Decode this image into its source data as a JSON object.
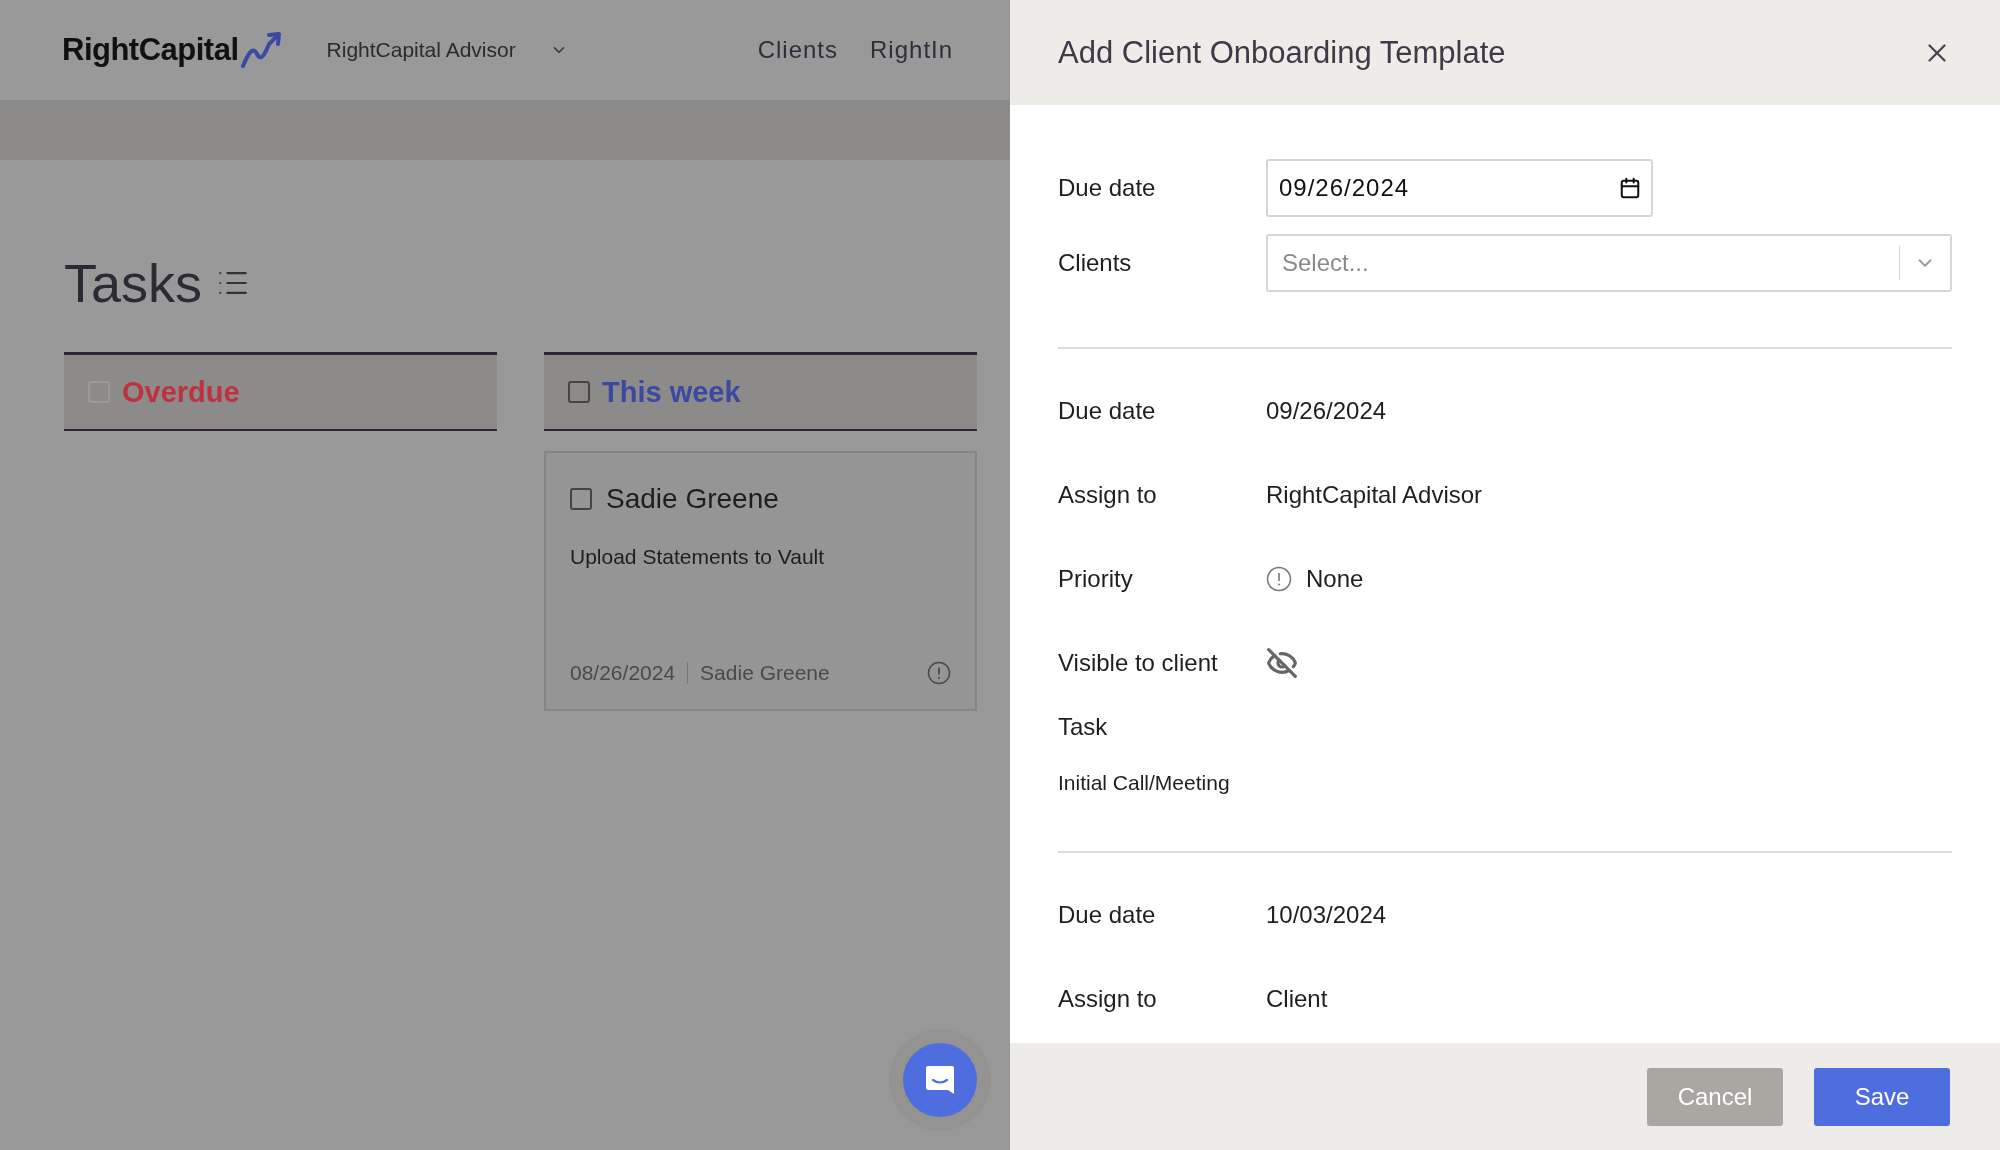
{
  "header": {
    "logo": "RightCapital",
    "advisor": "RightCapital Advisor",
    "nav": [
      "Clients",
      "RightIn"
    ]
  },
  "tasks": {
    "title": "Tasks",
    "columns": [
      {
        "title": "Overdue",
        "color": "#c0313f",
        "checked": false
      },
      {
        "title": "This week",
        "color": "#3a4aa0",
        "checked": false,
        "cards": [
          {
            "name": "Sadie Greene",
            "checked": false,
            "description": "Upload Statements to Vault",
            "date": "08/26/2024",
            "assignee": "Sadie Greene"
          }
        ]
      }
    ]
  },
  "panel": {
    "title": "Add Client Onboarding Template",
    "due_date": {
      "label": "Due date",
      "value": "09/26/2024"
    },
    "clients": {
      "label": "Clients",
      "placeholder": "Select..."
    },
    "sections": [
      {
        "rows": [
          {
            "kind": "text",
            "label": "Due date",
            "value": "09/26/2024"
          },
          {
            "kind": "text",
            "label": "Assign to",
            "value": "RightCapital Advisor"
          },
          {
            "kind": "priority",
            "label": "Priority",
            "value": "None"
          },
          {
            "kind": "visibility",
            "label": "Visible to client",
            "visible": false
          }
        ],
        "task_label": "Task",
        "task_name": "Initial Call/Meeting"
      },
      {
        "rows": [
          {
            "kind": "text",
            "label": "Due date",
            "value": "10/03/2024"
          },
          {
            "kind": "text",
            "label": "Assign to",
            "value": "Client"
          }
        ]
      }
    ],
    "buttons": {
      "cancel": "Cancel",
      "save": "Save"
    }
  }
}
